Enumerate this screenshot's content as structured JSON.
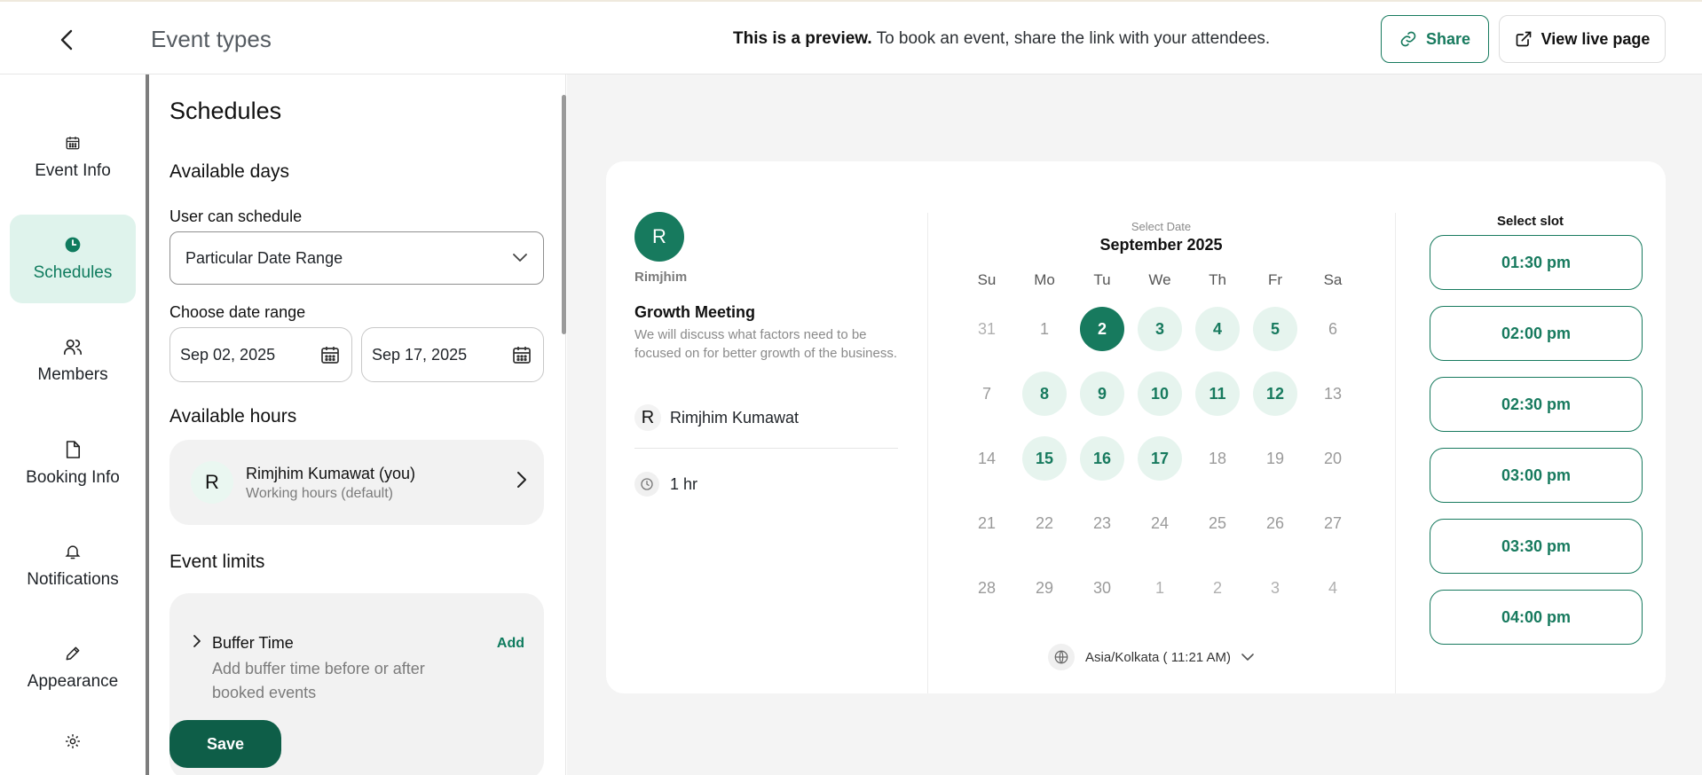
{
  "header": {
    "title": "Event types",
    "preview_bold": "This is a preview.",
    "preview_text": " To book an event, share the link with your attendees.",
    "share_label": "Share",
    "live_label": "View live page"
  },
  "nav": {
    "items": [
      {
        "label": "Event Info",
        "icon": "calendar-icon"
      },
      {
        "label": "Schedules",
        "icon": "clock-icon",
        "active": true
      },
      {
        "label": "Members",
        "icon": "users-icon"
      },
      {
        "label": "Booking Info",
        "icon": "file-icon"
      },
      {
        "label": "Notifications",
        "icon": "bell-icon"
      },
      {
        "label": "Appearance",
        "icon": "pencil-icon"
      },
      {
        "label": "",
        "icon": "gear-icon"
      }
    ]
  },
  "settings": {
    "title": "Schedules",
    "available_days": "Available days",
    "user_can_schedule_label": "User can schedule",
    "schedule_value": "Particular Date Range",
    "date_range_label": "Choose date range",
    "start_date": "Sep 02, 2025",
    "end_date": "Sep 17, 2025",
    "available_hours": "Available hours",
    "hours_avatar": "R",
    "hours_name": "Rimjhim Kumawat (you)",
    "hours_sub": "Working hours (default)",
    "event_limits": "Event limits",
    "buffer_title": "Buffer Time",
    "buffer_desc": "Add buffer time before or after booked events",
    "buffer_add": "Add",
    "save_label": "Save"
  },
  "preview": {
    "host_initial": "R",
    "host_name": "Rimjhim",
    "event_title": "Growth Meeting",
    "event_desc": "We will discuss what factors need to be focused on for better growth of the business.",
    "organizer_initial": "R",
    "organizer_name": "Rimjhim Kumawat",
    "duration": "1 hr",
    "select_date": "Select Date",
    "month": "September 2025",
    "weekdays": [
      "Su",
      "Mo",
      "Tu",
      "We",
      "Th",
      "Fr",
      "Sa"
    ],
    "weeks": [
      [
        {
          "d": "31",
          "s": "muted"
        },
        {
          "d": "1",
          "s": "plain"
        },
        {
          "d": "2",
          "s": "selected"
        },
        {
          "d": "3",
          "s": "avail"
        },
        {
          "d": "4",
          "s": "avail"
        },
        {
          "d": "5",
          "s": "avail"
        },
        {
          "d": "6",
          "s": "plain"
        }
      ],
      [
        {
          "d": "7",
          "s": "plain"
        },
        {
          "d": "8",
          "s": "avail"
        },
        {
          "d": "9",
          "s": "avail"
        },
        {
          "d": "10",
          "s": "avail"
        },
        {
          "d": "11",
          "s": "avail"
        },
        {
          "d": "12",
          "s": "avail"
        },
        {
          "d": "13",
          "s": "plain"
        }
      ],
      [
        {
          "d": "14",
          "s": "plain"
        },
        {
          "d": "15",
          "s": "avail"
        },
        {
          "d": "16",
          "s": "avail"
        },
        {
          "d": "17",
          "s": "avail"
        },
        {
          "d": "18",
          "s": "plain"
        },
        {
          "d": "19",
          "s": "plain"
        },
        {
          "d": "20",
          "s": "plain"
        }
      ],
      [
        {
          "d": "21",
          "s": "plain"
        },
        {
          "d": "22",
          "s": "plain"
        },
        {
          "d": "23",
          "s": "plain"
        },
        {
          "d": "24",
          "s": "plain"
        },
        {
          "d": "25",
          "s": "plain"
        },
        {
          "d": "26",
          "s": "plain"
        },
        {
          "d": "27",
          "s": "plain"
        }
      ],
      [
        {
          "d": "28",
          "s": "plain"
        },
        {
          "d": "29",
          "s": "plain"
        },
        {
          "d": "30",
          "s": "plain"
        },
        {
          "d": "1",
          "s": "muted"
        },
        {
          "d": "2",
          "s": "muted"
        },
        {
          "d": "3",
          "s": "muted"
        },
        {
          "d": "4",
          "s": "muted"
        }
      ]
    ],
    "timezone": "Asia/Kolkata ( 11:21 AM)",
    "slot_title": "Select slot",
    "slots": [
      "01:30 pm",
      "02:00 pm",
      "02:30 pm",
      "03:00 pm",
      "03:30 pm",
      "04:00 pm"
    ]
  },
  "colors": {
    "accent": "#177a5e",
    "accent_dark": "#0e5e48",
    "accent_light": "#e6f4ee"
  }
}
